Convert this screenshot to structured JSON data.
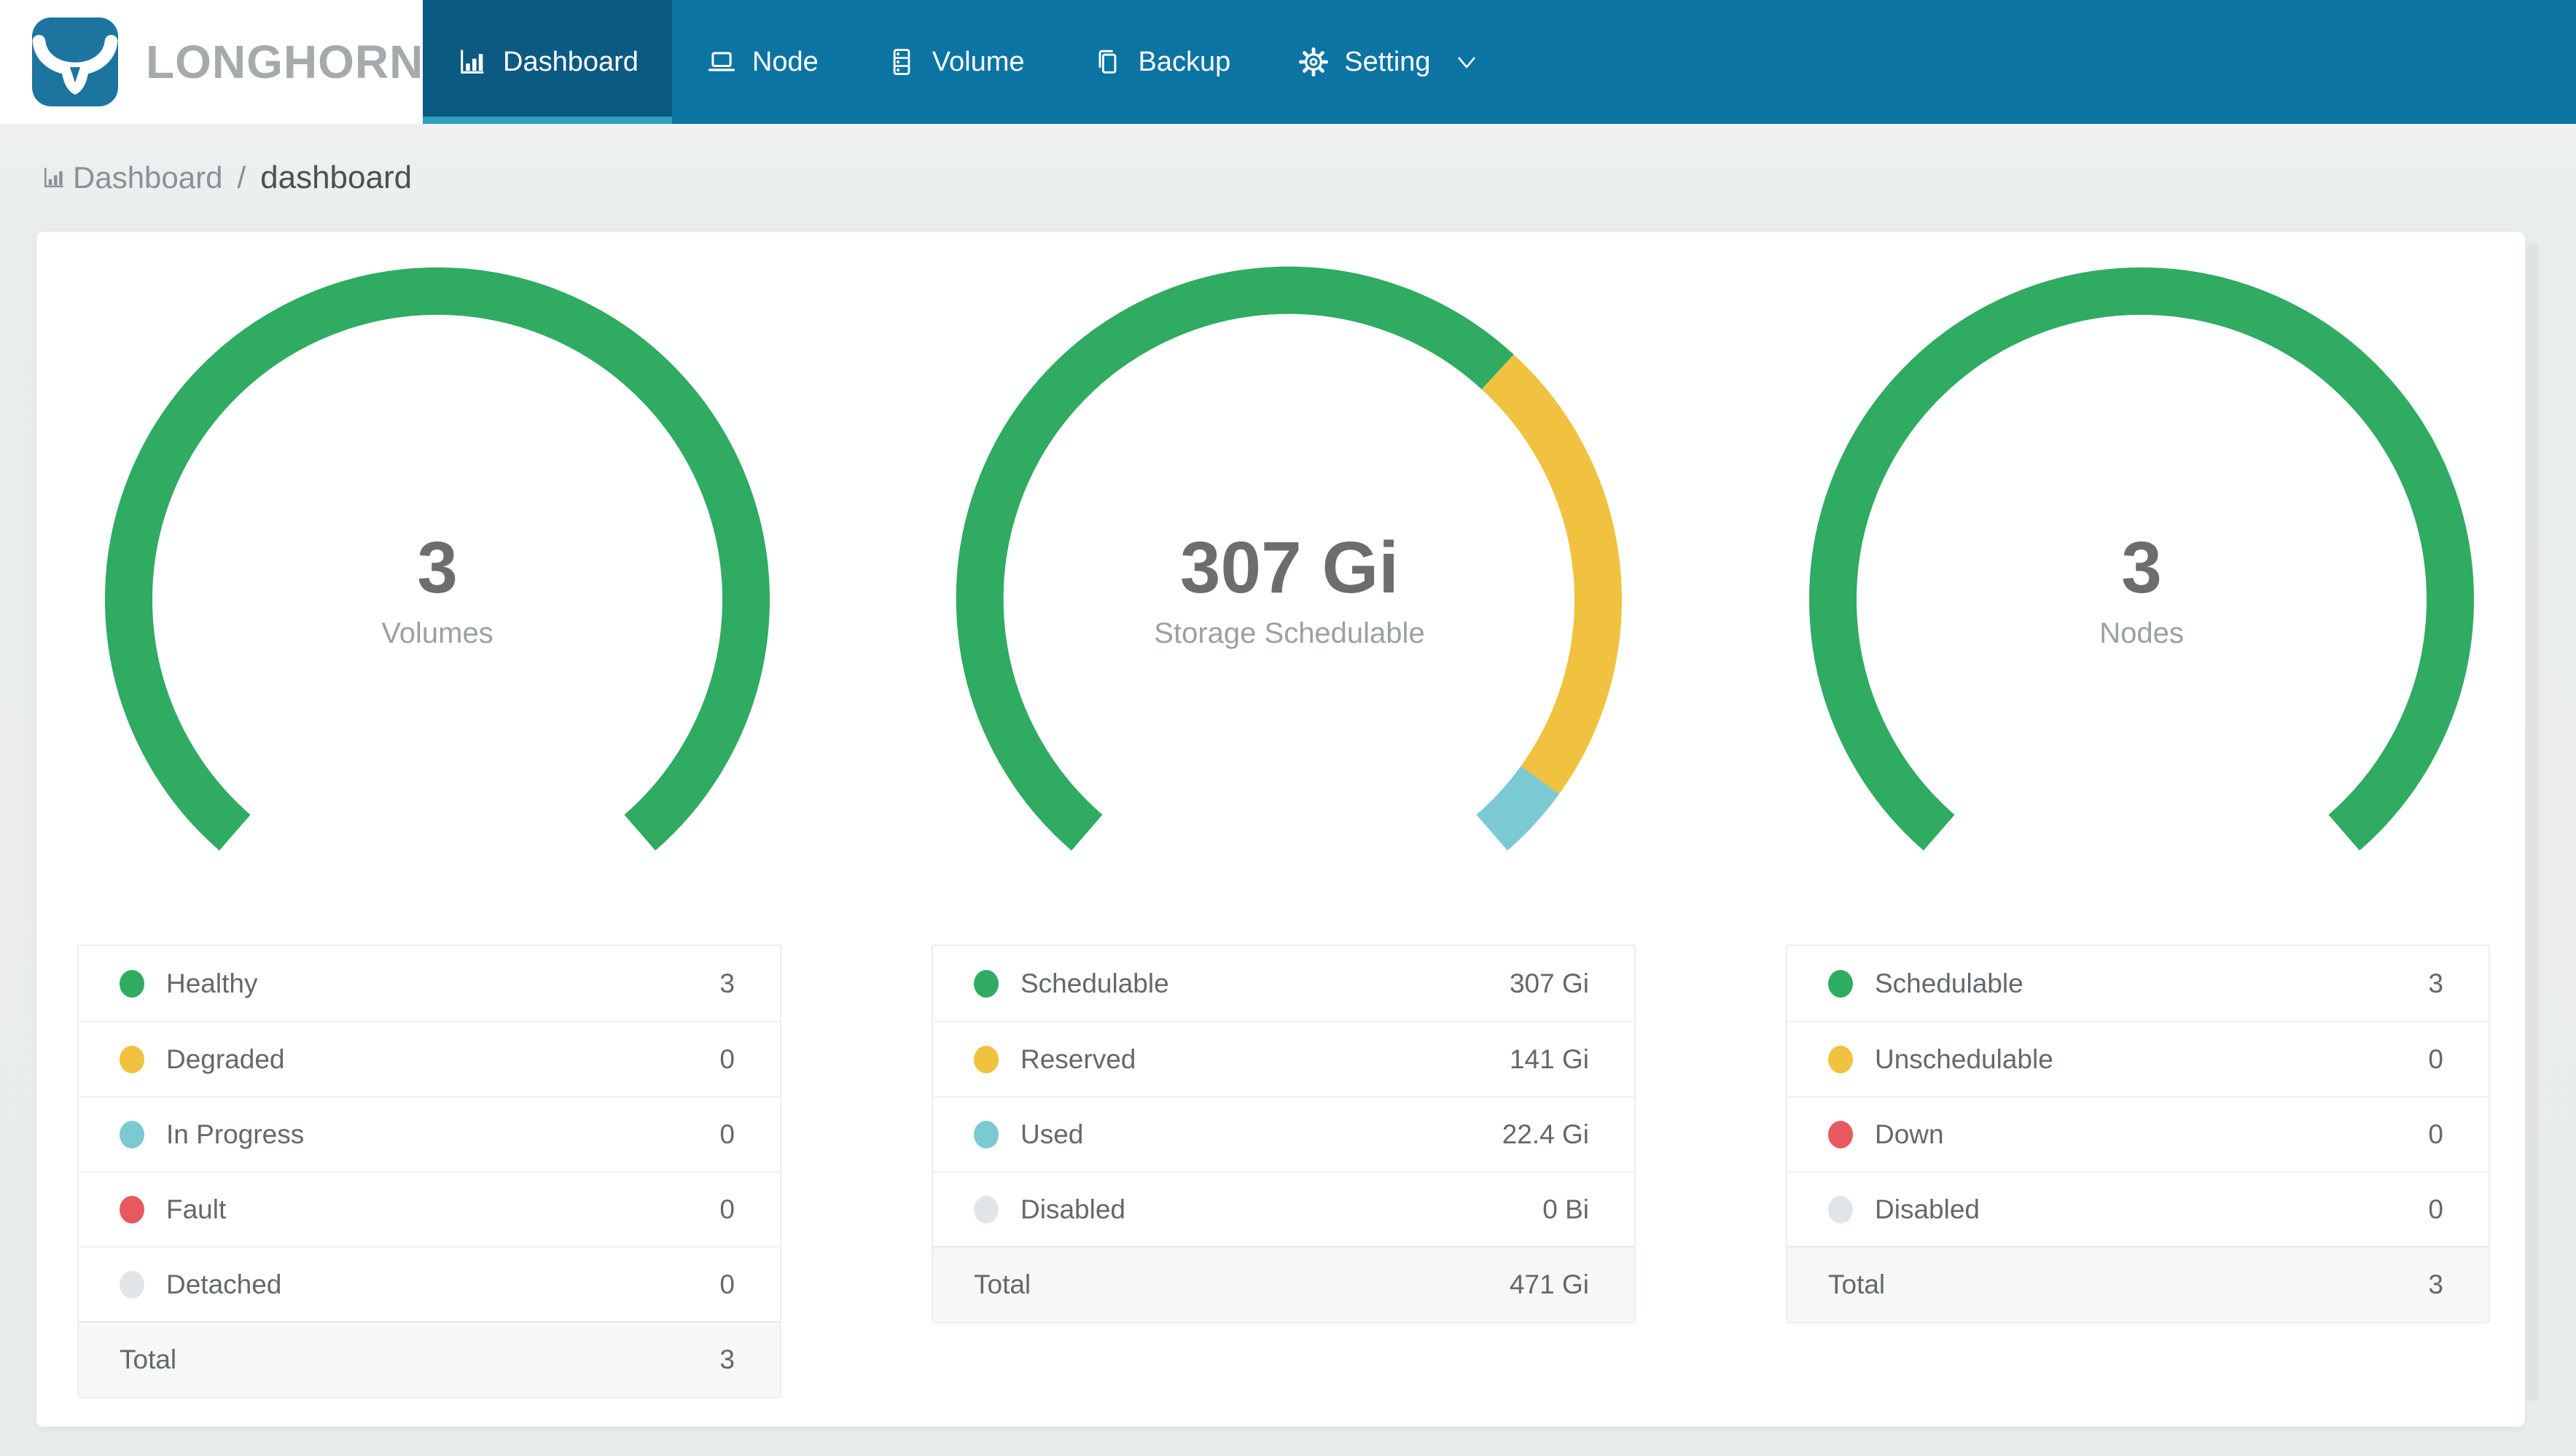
{
  "brand": {
    "name": "LONGHORN"
  },
  "nav": {
    "items": [
      {
        "label": "Dashboard",
        "icon": "bar-chart-icon",
        "active": true
      },
      {
        "label": "Node",
        "icon": "laptop-icon",
        "active": false
      },
      {
        "label": "Volume",
        "icon": "database-icon",
        "active": false
      },
      {
        "label": "Backup",
        "icon": "copy-icon",
        "active": false
      },
      {
        "label": "Setting",
        "icon": "gear-icon",
        "active": false,
        "dropdown": true
      }
    ]
  },
  "breadcrumb": {
    "section": "Dashboard",
    "separator": "/",
    "page": "dashboard"
  },
  "colors": {
    "navbar": "#0b74a3",
    "navbar_active": "#0a5a82",
    "navbar_active_underline": "#2ba0bf",
    "brand_text": "#a5aaad",
    "green": "#2fab62",
    "yellow": "#f0c23f",
    "teal": "#7bc9d2",
    "red": "#e85860",
    "gray": "#e2e5e7"
  },
  "chart_data": [
    {
      "type": "gauge",
      "center_value": "3",
      "center_label": "Volumes",
      "arc_segments": [
        {
          "color": "green",
          "value": 3
        },
        {
          "color": "yellow",
          "value": 0
        },
        {
          "color": "teal",
          "value": 0
        },
        {
          "color": "red",
          "value": 0
        },
        {
          "color": "gray",
          "value": 0
        }
      ],
      "legend": [
        {
          "label": "Healthy",
          "color": "green",
          "value": "3"
        },
        {
          "label": "Degraded",
          "color": "yellow",
          "value": "0"
        },
        {
          "label": "In Progress",
          "color": "teal",
          "value": "0"
        },
        {
          "label": "Fault",
          "color": "red",
          "value": "0"
        },
        {
          "label": "Detached",
          "color": "gray",
          "value": "0"
        }
      ],
      "total": {
        "label": "Total",
        "value": "3"
      }
    },
    {
      "type": "gauge",
      "center_value": "307 Gi",
      "center_label": "Storage Schedulable",
      "arc_segments": [
        {
          "color": "green",
          "value": 307
        },
        {
          "color": "yellow",
          "value": 141
        },
        {
          "color": "teal",
          "value": 22.4
        },
        {
          "color": "gray",
          "value": 0
        }
      ],
      "legend": [
        {
          "label": "Schedulable",
          "color": "green",
          "value": "307 Gi"
        },
        {
          "label": "Reserved",
          "color": "yellow",
          "value": "141 Gi"
        },
        {
          "label": "Used",
          "color": "teal",
          "value": "22.4 Gi"
        },
        {
          "label": "Disabled",
          "color": "gray",
          "value": "0 Bi"
        }
      ],
      "total": {
        "label": "Total",
        "value": "471 Gi"
      }
    },
    {
      "type": "gauge",
      "center_value": "3",
      "center_label": "Nodes",
      "arc_segments": [
        {
          "color": "green",
          "value": 3
        },
        {
          "color": "yellow",
          "value": 0
        },
        {
          "color": "red",
          "value": 0
        },
        {
          "color": "gray",
          "value": 0
        }
      ],
      "legend": [
        {
          "label": "Schedulable",
          "color": "green",
          "value": "3"
        },
        {
          "label": "Unschedulable",
          "color": "yellow",
          "value": "0"
        },
        {
          "label": "Down",
          "color": "red",
          "value": "0"
        },
        {
          "label": "Disabled",
          "color": "gray",
          "value": "0"
        }
      ],
      "total": {
        "label": "Total",
        "value": "3"
      }
    }
  ]
}
